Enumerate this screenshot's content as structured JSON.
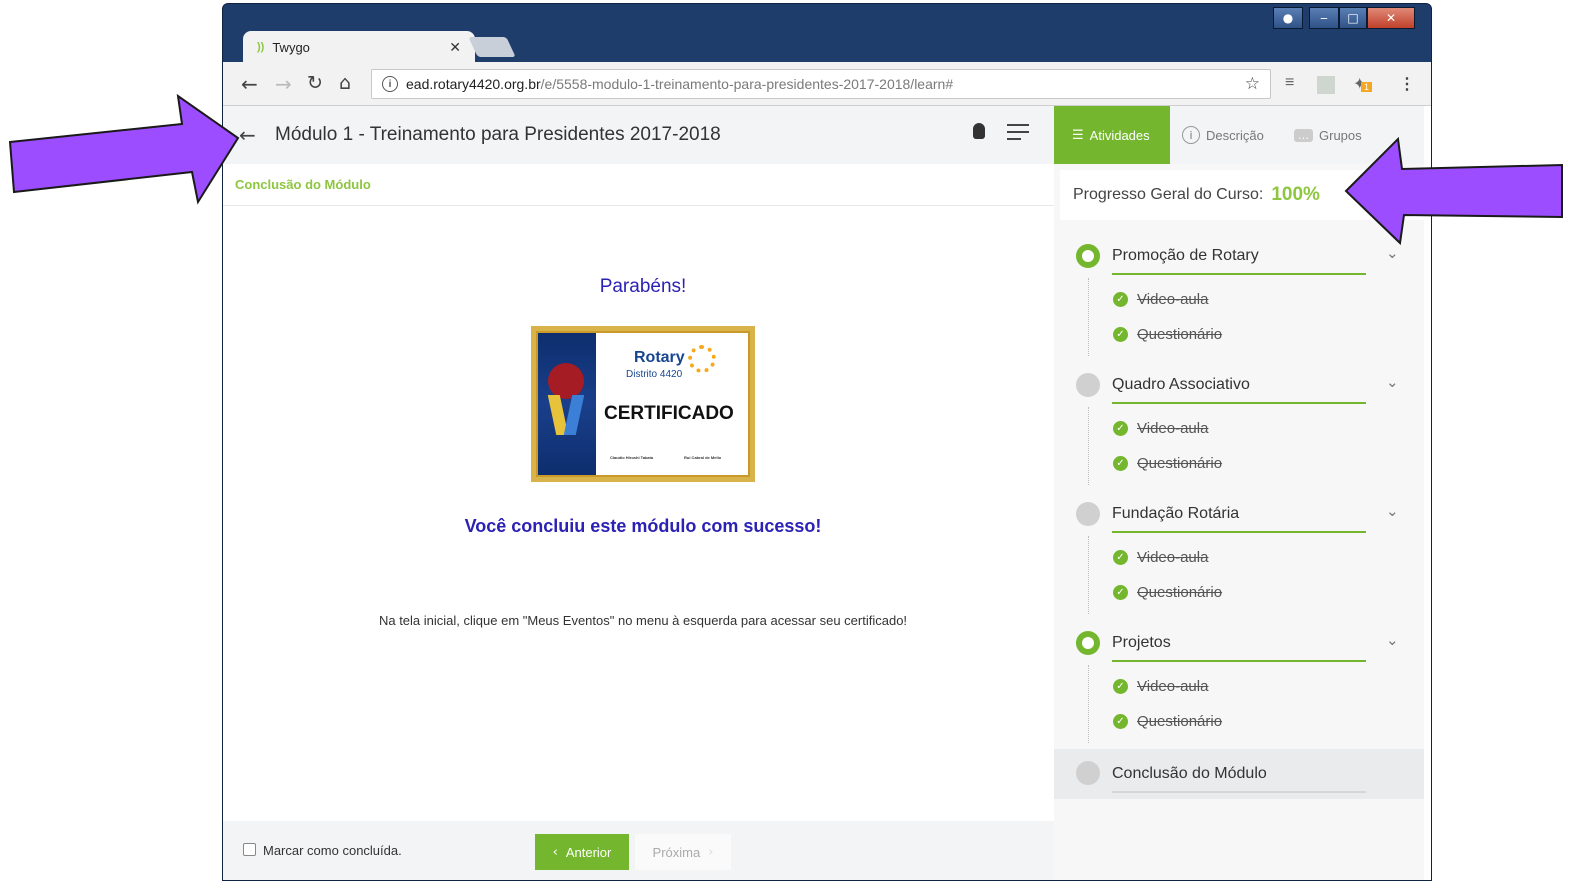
{
  "browser": {
    "tab_title": "Twygo",
    "tab_favicon": "))",
    "url_host": "ead.rotary4420.org.br",
    "url_path": "/e/5558-modulo-1-treinamento-para-presidentes-2017-2018/learn#",
    "extension_badge": "1"
  },
  "module": {
    "title": "Módulo 1 - Treinamento para Presidentes 2017-2018",
    "breadcrumb": "Conclusão do Módulo"
  },
  "content": {
    "congrats": "Parabéns!",
    "certificate": {
      "brand": "Rotary",
      "district": "Distrito 4420",
      "title": "CERTIFICADO",
      "sig1": "Claudio Hiroshi Takata",
      "sig2": "Rui Cabral de Mello"
    },
    "success": "Você concluiu este módulo com sucesso!",
    "note": "Na tela inicial, clique em \"Meus Eventos\" no menu à esquerda para acessar seu certificado!"
  },
  "footer": {
    "checkbox_label": "Marcar como concluída.",
    "prev_label": "Anterior",
    "next_label": "Próxima"
  },
  "sidebar": {
    "tabs": [
      {
        "label": "Atividades",
        "active": true
      },
      {
        "label": "Descrição",
        "active": false
      },
      {
        "label": "Grupos",
        "active": false
      }
    ],
    "progress_label": "Progresso Geral do Curso:",
    "progress_value": "100%",
    "sections": [
      {
        "title": "Promoção de Rotary",
        "complete": true,
        "items": [
          "Video-aula",
          "Questionário"
        ]
      },
      {
        "title": "Quadro Associativo",
        "complete": false,
        "items": [
          "Video-aula",
          "Questionário"
        ]
      },
      {
        "title": "Fundação Rotária",
        "complete": false,
        "items": [
          "Video-aula",
          "Questionário"
        ]
      },
      {
        "title": "Projetos",
        "complete": true,
        "items": [
          "Video-aula",
          "Questionário"
        ]
      }
    ],
    "final_section": "Conclusão do Módulo"
  },
  "colors": {
    "accent_green": "#74b72e",
    "heading_blue": "#2b22b5",
    "arrow_purple": "#9b4dff"
  }
}
